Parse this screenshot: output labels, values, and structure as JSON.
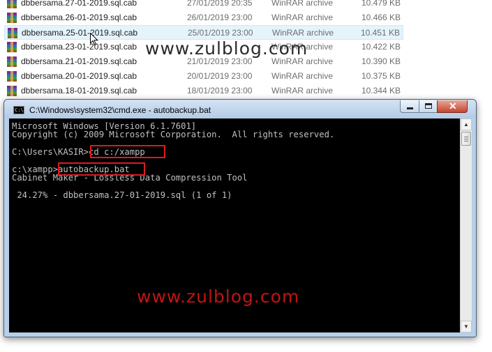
{
  "files": [
    {
      "name": "dbbersama.27-01-2019.sql.cab",
      "date": "27/01/2019 20:35",
      "type": "WinRAR archive",
      "size": "10.479 KB"
    },
    {
      "name": "dbbersama.26-01-2019.sql.cab",
      "date": "26/01/2019 23:00",
      "type": "WinRAR archive",
      "size": "10.466 KB"
    },
    {
      "name": "dbbersama.25-01-2019.sql.cab",
      "date": "25/01/2019 23:00",
      "type": "WinRAR archive",
      "size": "10.451 KB"
    },
    {
      "name": "dbbersama.23-01-2019.sql.cab",
      "date": "",
      "type": "WinRAR archive",
      "size": "10.422 KB"
    },
    {
      "name": "dbbersama.21-01-2019.sql.cab",
      "date": "21/01/2019 23:00",
      "type": "WinRAR archive",
      "size": "10.390 KB"
    },
    {
      "name": "dbbersama.20-01-2019.sql.cab",
      "date": "20/01/2019 23:00",
      "type": "WinRAR archive",
      "size": "10.375 KB"
    },
    {
      "name": "dbbersama.18-01-2019.sql.cab",
      "date": "18/01/2019 23:00",
      "type": "WinRAR archive",
      "size": "10.344 KB"
    }
  ],
  "watermark": "www.zulblog.com",
  "cmd": {
    "title": "C:\\Windows\\system32\\cmd.exe - autobackup.bat",
    "icon_text": "C:\\",
    "lines": [
      "Microsoft Windows [Version 6.1.7601]",
      "Copyright (c) 2009 Microsoft Corporation.  All rights reserved.",
      "C:\\Users\\KASIR>cd c:/xampp",
      "c:\\xampp>autobackup.bat",
      "Cabinet Maker - Lossless Data Compression Tool",
      " 24.27% - dbbersama.27-01-2019.sql (1 of 1)"
    ]
  },
  "colors": {
    "highlight": "#e0191f",
    "watermark_bottom": "#c01414",
    "console_bg": "#000000",
    "console_text": "#c0c0c0"
  }
}
